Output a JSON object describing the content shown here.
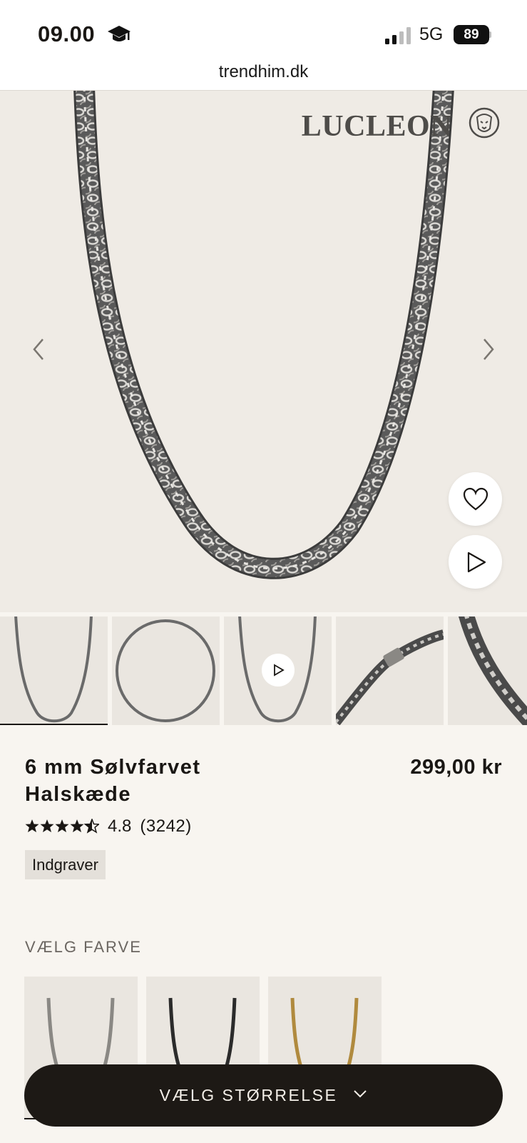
{
  "status_bar": {
    "time": "09.00",
    "network": "5G",
    "battery": "89",
    "icons": [
      "graduation-cap-icon",
      "signal-icon",
      "battery-icon"
    ]
  },
  "browser": {
    "url": "trendhim.dk"
  },
  "hero": {
    "brand": "LUCLEON",
    "brand_icon": "lion-head-icon",
    "icons": [
      "chevron-left-icon",
      "chevron-right-icon",
      "heart-icon",
      "play-icon"
    ]
  },
  "thumbnails": {
    "count": 5,
    "active_index": 0,
    "items": [
      {
        "view": "necklace-front"
      },
      {
        "view": "necklace-full-circle"
      },
      {
        "view": "necklace-video"
      },
      {
        "view": "clasp-closeup"
      },
      {
        "view": "links-closeup"
      }
    ]
  },
  "product": {
    "title": "6 mm Sølvfarvet Halskæde",
    "price": "299,00 kr",
    "rating": "4.8",
    "rating_count": "(3242)",
    "stars": 4.5,
    "tag": "Indgraver"
  },
  "color_section": {
    "label": "VÆLG FARVE",
    "swatches": [
      {
        "name": "silver",
        "color": "#8a8884",
        "selected": true
      },
      {
        "name": "black",
        "color": "#2b2b2b",
        "selected": false
      },
      {
        "name": "gold",
        "color": "#b08a3e",
        "selected": false
      }
    ]
  },
  "cta": {
    "label": "VÆLG STØRRELSE",
    "icon": "chevron-down-icon"
  },
  "colors": {
    "page_bg": "#f8f5f0",
    "hero_bg": "#efebe5",
    "cta_bg": "#1d1915",
    "text": "#1a1714"
  }
}
